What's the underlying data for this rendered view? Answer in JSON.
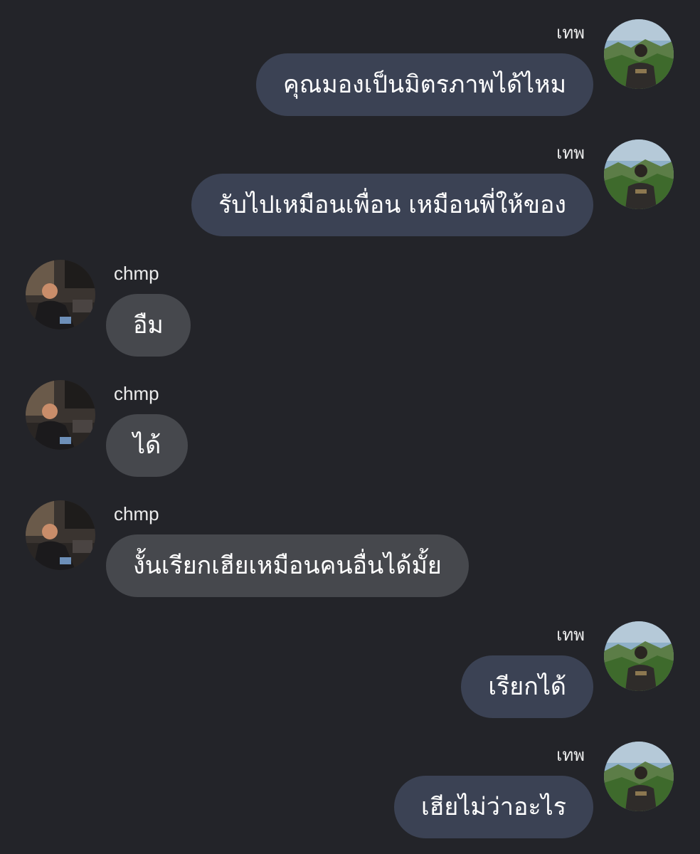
{
  "colors": {
    "background": "#232429",
    "outgoing_bubble": "#3b4254",
    "incoming_bubble": "#46484d",
    "text": "#ffffff"
  },
  "messages": [
    {
      "sender": "เทพ",
      "text": "คุณมองเป็นมิตรภาพได้ไหม",
      "direction": "outgoing",
      "avatar": "landscape-photo-avatar"
    },
    {
      "sender": "เทพ",
      "text": "รับไปเหมือนเพื่อน เหมือนพี่ให้ของ",
      "direction": "outgoing",
      "avatar": "landscape-photo-avatar"
    },
    {
      "sender": "chmp",
      "text": "อืม",
      "direction": "incoming",
      "avatar": "indoor-photo-avatar"
    },
    {
      "sender": "chmp",
      "text": "ได้",
      "direction": "incoming",
      "avatar": "indoor-photo-avatar"
    },
    {
      "sender": "chmp",
      "text": "งั้นเรียกเฮียเหมือนคนอื่นได้มั้ย",
      "direction": "incoming",
      "avatar": "indoor-photo-avatar"
    },
    {
      "sender": "เทพ",
      "text": "เรียกได้",
      "direction": "outgoing",
      "avatar": "landscape-photo-avatar"
    },
    {
      "sender": "เทพ",
      "text": "เฮียไม่ว่าอะไร",
      "direction": "outgoing",
      "avatar": "landscape-photo-avatar"
    }
  ]
}
